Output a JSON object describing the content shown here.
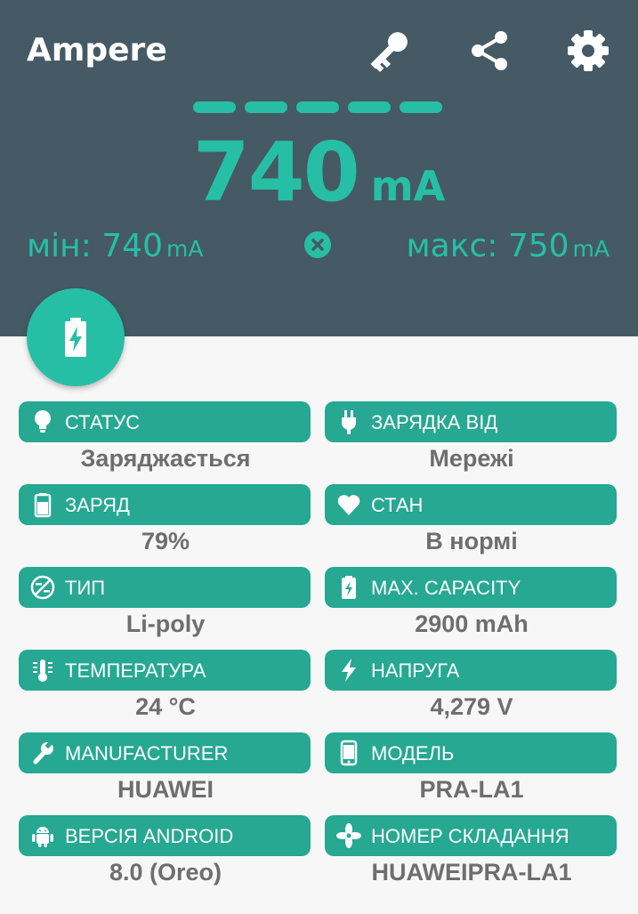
{
  "app": {
    "title": "Ampere"
  },
  "toolbar": {
    "icons": [
      "key-icon",
      "share-icon",
      "settings-icon"
    ]
  },
  "meter": {
    "current_value": "740",
    "current_unit": "mA",
    "min_label": "мін: 740",
    "min_unit": "mA",
    "max_label": "макс: 750",
    "max_unit": "mA",
    "dashes": 5
  },
  "colors": {
    "header": "#455a64",
    "accent": "#26bfa6",
    "pill": "#26a892",
    "value_text": "#6e6e6e"
  },
  "cards": [
    {
      "icon": "lightbulb-icon",
      "label": "СТАТУС",
      "value": "Заряджається"
    },
    {
      "icon": "plug-icon",
      "label": "ЗАРЯДКА ВІД",
      "value": "Мережі"
    },
    {
      "icon": "battery-icon",
      "label": "ЗАРЯД",
      "value": "79%"
    },
    {
      "icon": "heart-icon",
      "label": "СТАН",
      "value": "В нормі"
    },
    {
      "icon": "tech-icon",
      "label": "ТИП",
      "value": "Li-poly"
    },
    {
      "icon": "battery-charging-icon",
      "label": "MAX. CAPACITY",
      "value": "2900 mAh"
    },
    {
      "icon": "thermometer-icon",
      "label": "ТЕМПЕРАТУРА",
      "value": "24 °C"
    },
    {
      "icon": "bolt-icon",
      "label": "НАПРУГА",
      "value": "4,279 V"
    },
    {
      "icon": "wrench-icon",
      "label": "MANUFACTURER",
      "value": "HUAWEI"
    },
    {
      "icon": "phone-icon",
      "label": "МОДЕЛЬ",
      "value": "PRA-LA1"
    },
    {
      "icon": "android-icon",
      "label": "ВЕРСІЯ ANDROID",
      "value": "8.0 (Oreo)"
    },
    {
      "icon": "fan-icon",
      "label": "НОМЕР СКЛАДАННЯ",
      "value": "HUAWEIPRA-LA1"
    }
  ]
}
